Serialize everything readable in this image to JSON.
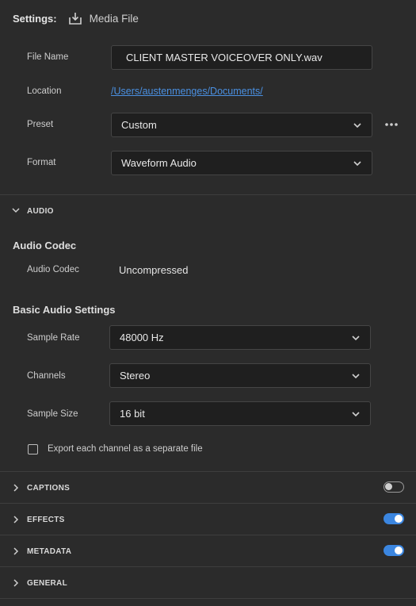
{
  "header": {
    "title": "Settings:",
    "icon": "download-icon",
    "label": "Media File"
  },
  "file": {
    "name_label": "File Name",
    "name_value": "CLIENT MASTER VOICEOVER ONLY.wav",
    "location_label": "Location",
    "location_value": "/Users/austenmenges/Documents/",
    "preset_label": "Preset",
    "preset_value": "Custom",
    "format_label": "Format",
    "format_value": "Waveform Audio"
  },
  "audio": {
    "section_label": "AUDIO",
    "codec_title": "Audio Codec",
    "codec_label": "Audio Codec",
    "codec_value": "Uncompressed",
    "basic_title": "Basic Audio Settings",
    "sample_rate_label": "Sample Rate",
    "sample_rate_value": "48000 Hz",
    "channels_label": "Channels",
    "channels_value": "Stereo",
    "sample_size_label": "Sample Size",
    "sample_size_value": "16 bit",
    "separate_label": "Export each channel as a separate file",
    "separate_checked": false
  },
  "sections": {
    "captions": {
      "label": "CAPTIONS",
      "enabled": false
    },
    "effects": {
      "label": "EFFECTS",
      "enabled": true
    },
    "metadata": {
      "label": "METADATA",
      "enabled": true
    },
    "general": {
      "label": "GENERAL"
    }
  },
  "colors": {
    "accent": "#3b86e0",
    "link": "#4a90e2",
    "background": "#2b2b2b"
  }
}
